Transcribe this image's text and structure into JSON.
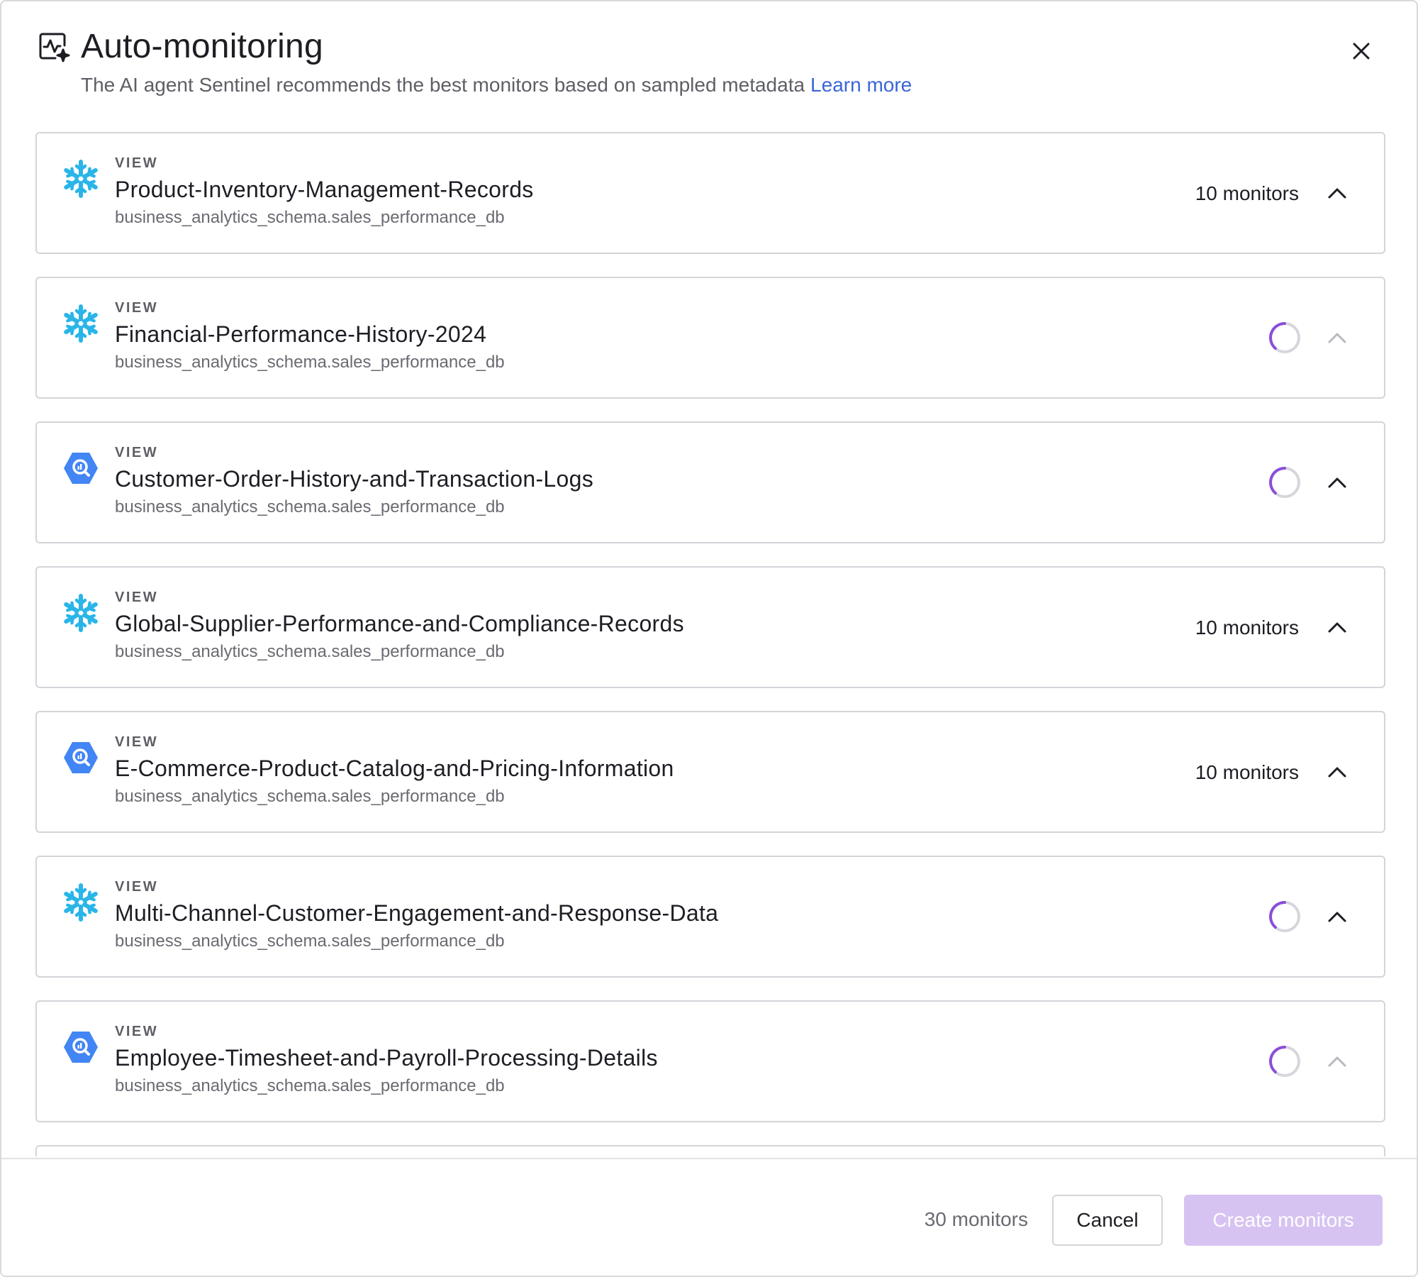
{
  "header": {
    "title": "Auto-monitoring",
    "subtitle": "The AI agent Sentinel recommends the best monitors based on sampled metadata",
    "learn_more": "Learn more",
    "icon": "sparkle-chart-icon",
    "close_icon": "close-icon"
  },
  "colors": {
    "snowflake": "#29B5E8",
    "bigquery": "#4285F4",
    "spinner": "#8A4FD8",
    "link": "#3966D6",
    "create_button_disabled": "#D7C3F2"
  },
  "cards": [
    {
      "source": "snowflake",
      "icon": "snowflake-icon",
      "kind": "VIEW",
      "name": "Product-Inventory-Management-Records",
      "path": "business_analytics_schema.sales_performance_db",
      "status": "done",
      "count": "10 monitors",
      "chevron_dim": false
    },
    {
      "source": "snowflake",
      "icon": "snowflake-icon",
      "kind": "VIEW",
      "name": "Financial-Performance-History-2024",
      "path": "business_analytics_schema.sales_performance_db",
      "status": "loading",
      "count": "",
      "chevron_dim": true
    },
    {
      "source": "bigquery",
      "icon": "bigquery-icon",
      "kind": "VIEW",
      "name": "Customer-Order-History-and-Transaction-Logs",
      "path": "business_analytics_schema.sales_performance_db",
      "status": "loading",
      "count": "",
      "chevron_dim": false
    },
    {
      "source": "snowflake",
      "icon": "snowflake-icon",
      "kind": "VIEW",
      "name": "Global-Supplier-Performance-and-Compliance-Records",
      "path": "business_analytics_schema.sales_performance_db",
      "status": "done",
      "count": "10 monitors",
      "chevron_dim": false
    },
    {
      "source": "bigquery",
      "icon": "bigquery-icon",
      "kind": "VIEW",
      "name": "E-Commerce-Product-Catalog-and-Pricing-Information",
      "path": "business_analytics_schema.sales_performance_db",
      "status": "done",
      "count": "10 monitors",
      "chevron_dim": false
    },
    {
      "source": "snowflake",
      "icon": "snowflake-icon",
      "kind": "VIEW",
      "name": "Multi-Channel-Customer-Engagement-and-Response-Data",
      "path": "business_analytics_schema.sales_performance_db",
      "status": "loading",
      "count": "",
      "chevron_dim": false
    },
    {
      "source": "bigquery",
      "icon": "bigquery-icon",
      "kind": "VIEW",
      "name": "Employee-Timesheet-and-Payroll-Processing-Details",
      "path": "business_analytics_schema.sales_performance_db",
      "status": "loading",
      "count": "",
      "chevron_dim": true
    }
  ],
  "footer": {
    "total": "30 monitors",
    "cancel_label": "Cancel",
    "create_label": "Create monitors"
  }
}
